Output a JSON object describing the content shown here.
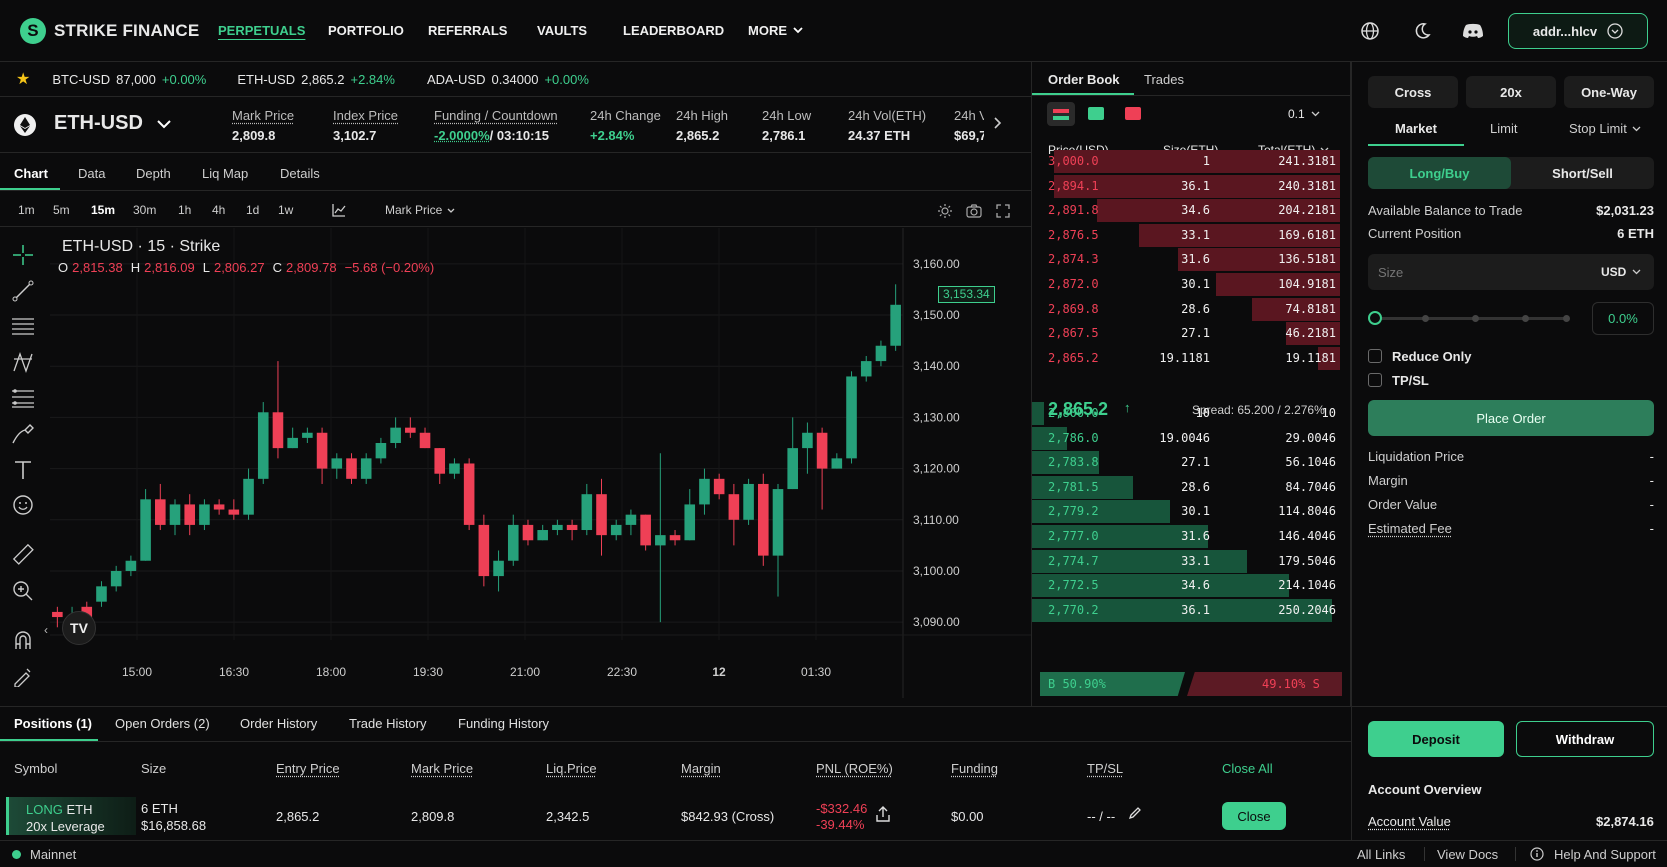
{
  "brand": {
    "name": "STRIKE FINANCE"
  },
  "nav": {
    "items": [
      "PERPETUALS",
      "PORTFOLIO",
      "REFERRALS",
      "VAULTS",
      "LEADERBOARD",
      "MORE"
    ],
    "address": "addr...hlcv"
  },
  "ticker": [
    {
      "symbol": "BTC-USD",
      "price": "87,000",
      "change": "+0.00%"
    },
    {
      "symbol": "ETH-USD",
      "price": "2,865.2",
      "change": "+2.84%"
    },
    {
      "symbol": "ADA-USD",
      "price": "0.34000",
      "change": "+0.00%"
    }
  ],
  "market": {
    "symbol": "ETH-USD",
    "stats": [
      {
        "label": "Mark Price",
        "value": "2,809.8"
      },
      {
        "label": "Index Price",
        "value": "3,102.7"
      },
      {
        "label": "Funding / Countdown",
        "value_a": "-2.0000%",
        "value_b": "/ 03:10:15"
      },
      {
        "label": "24h Change",
        "value": "+2.84%"
      },
      {
        "label": "24h High",
        "value": "2,865.2"
      },
      {
        "label": "24h Low",
        "value": "2,786.1"
      },
      {
        "label": "24h Vol(ETH)",
        "value": "24.37 ETH"
      },
      {
        "label": "24h V",
        "value": "$69,7"
      }
    ]
  },
  "chart_tabs": [
    "Chart",
    "Data",
    "Depth",
    "Liq Map",
    "Details"
  ],
  "timeframes": [
    "1m",
    "5m",
    "15m",
    "30m",
    "1h",
    "4h",
    "1d",
    "1w"
  ],
  "price_source": "Mark Price",
  "chart": {
    "title": "ETH-USD · 15 · Strike",
    "ohlc": {
      "o_label": "O",
      "o": "2,815.38",
      "h_label": "H",
      "h": "2,816.09",
      "l_label": "L",
      "l": "2,806.27",
      "c_label": "C",
      "c": "2,809.78",
      "chg": "−5.68 (−0.20%)"
    },
    "last_price_tag": "3,153.34"
  },
  "chart_data": {
    "type": "candlestick",
    "x_labels": [
      "15:00",
      "16:30",
      "18:00",
      "19:30",
      "21:00",
      "22:30",
      "12",
      "01:30"
    ],
    "y_ticks": [
      3160,
      3150,
      3140,
      3130,
      3120,
      3110,
      3100,
      3090
    ],
    "ylim": [
      3083,
      3167
    ],
    "candles": [
      [
        3092,
        3091,
        3093,
        3089
      ],
      [
        3089,
        3091,
        3093,
        3088
      ],
      [
        3093,
        3088,
        3094,
        3087
      ],
      [
        3094,
        3097,
        3098,
        3093
      ],
      [
        3097,
        3100,
        3101,
        3096
      ],
      [
        3100,
        3102,
        3103,
        3099
      ],
      [
        3102,
        3114,
        3116,
        3102
      ],
      [
        3114,
        3109,
        3117,
        3108
      ],
      [
        3109,
        3113,
        3114,
        3107
      ],
      [
        3113,
        3109,
        3115,
        3107
      ],
      [
        3109,
        3113,
        3114,
        3108
      ],
      [
        3113,
        3112,
        3114,
        3111
      ],
      [
        3112,
        3111,
        3114,
        3110
      ],
      [
        3111,
        3118,
        3120,
        3110
      ],
      [
        3118,
        3131,
        3133,
        3117
      ],
      [
        3131,
        3124,
        3141,
        3122
      ],
      [
        3124,
        3126,
        3128,
        3124
      ],
      [
        3126,
        3127,
        3128,
        3125
      ],
      [
        3127,
        3120,
        3128,
        3117
      ],
      [
        3120,
        3122,
        3123,
        3118
      ],
      [
        3122,
        3118,
        3123,
        3117
      ],
      [
        3118,
        3122,
        3123,
        3117
      ],
      [
        3122,
        3125,
        3126,
        3121
      ],
      [
        3125,
        3128,
        3130,
        3124
      ],
      [
        3128,
        3127,
        3130,
        3126
      ],
      [
        3127,
        3124,
        3128,
        3124
      ],
      [
        3124,
        3119,
        3124,
        3117
      ],
      [
        3119,
        3121,
        3122,
        3118
      ],
      [
        3121,
        3109,
        3122,
        3108
      ],
      [
        3109,
        3099,
        3111,
        3097
      ],
      [
        3099,
        3102,
        3104,
        3096
      ],
      [
        3102,
        3109,
        3111,
        3101
      ],
      [
        3109,
        3106,
        3110,
        3105
      ],
      [
        3106,
        3108,
        3109,
        3106
      ],
      [
        3108,
        3109,
        3110,
        3107
      ],
      [
        3109,
        3108,
        3110,
        3106
      ],
      [
        3108,
        3115,
        3117,
        3107
      ],
      [
        3115,
        3107,
        3118,
        3103
      ],
      [
        3107,
        3109,
        3110,
        3106
      ],
      [
        3109,
        3111,
        3112,
        3107
      ],
      [
        3111,
        3105,
        3111,
        3104
      ],
      [
        3105,
        3107,
        3123,
        3090
      ],
      [
        3107,
        3106,
        3108,
        3105
      ],
      [
        3106,
        3113,
        3116,
        3106
      ],
      [
        3113,
        3118,
        3120,
        3111
      ],
      [
        3118,
        3115,
        3119,
        3114
      ],
      [
        3115,
        3110,
        3117,
        3105
      ],
      [
        3110,
        3117,
        3118,
        3109
      ],
      [
        3117,
        3103,
        3119,
        3101
      ],
      [
        3103,
        3116,
        3117,
        3095
      ],
      [
        3116,
        3124,
        3130,
        3116
      ],
      [
        3124,
        3127,
        3129,
        3119
      ],
      [
        3127,
        3120,
        3128,
        3112
      ],
      [
        3120,
        3122,
        3123,
        3120
      ],
      [
        3122,
        3138,
        3139,
        3121
      ],
      [
        3138,
        3141,
        3142,
        3137
      ],
      [
        3141,
        3144,
        3145,
        3140
      ],
      [
        3144,
        3152,
        3156,
        3143
      ]
    ]
  },
  "orderbook": {
    "tabs": [
      "Order Book",
      "Trades"
    ],
    "grouping": "0.1",
    "headers": [
      "Price(USD)",
      "Size(ETH)",
      "Total(ETH)"
    ],
    "asks": [
      [
        "3,000.0",
        "1",
        "241.3181"
      ],
      [
        "2,894.1",
        "36.1",
        "240.3181"
      ],
      [
        "2,891.8",
        "34.6",
        "204.2181"
      ],
      [
        "2,876.5",
        "33.1",
        "169.6181"
      ],
      [
        "2,874.3",
        "31.6",
        "136.5181"
      ],
      [
        "2,872.0",
        "30.1",
        "104.9181"
      ],
      [
        "2,869.8",
        "28.6",
        "74.8181"
      ],
      [
        "2,867.5",
        "27.1",
        "46.2181"
      ],
      [
        "2,865.2",
        "19.1181",
        "19.1181"
      ]
    ],
    "ask_depth": [
      0.955,
      0.955,
      0.81,
      0.67,
      0.54,
      0.415,
      0.295,
      0.18,
      0.075
    ],
    "mid_price": "2,865.2",
    "spread": "Spread: 65.200 / 2.276%",
    "bids": [
      [
        "2,800.0",
        "10",
        "10"
      ],
      [
        "2,786.0",
        "19.0046",
        "29.0046"
      ],
      [
        "2,783.8",
        "27.1",
        "56.1046"
      ],
      [
        "2,781.5",
        "28.6",
        "84.7046"
      ],
      [
        "2,779.2",
        "30.1",
        "114.8046"
      ],
      [
        "2,777.0",
        "31.6",
        "146.4046"
      ],
      [
        "2,774.7",
        "33.1",
        "179.5046"
      ],
      [
        "2,772.5",
        "34.6",
        "214.1046"
      ],
      [
        "2,770.2",
        "36.1",
        "250.2046"
      ]
    ],
    "bid_depth": [
      0.04,
      0.116,
      0.224,
      0.338,
      0.459,
      0.585,
      0.717,
      0.856,
      1.0
    ],
    "buy_ratio": "B 50.90%",
    "sell_ratio": "49.10% S"
  },
  "order_form": {
    "margin_mode": "Cross",
    "leverage": "20x",
    "position_mode": "One-Way",
    "order_types": [
      "Market",
      "Limit",
      "Stop Limit"
    ],
    "side_buy": "Long/Buy",
    "side_sell": "Short/Sell",
    "available_label": "Available Balance to Trade",
    "available_value": "$2,031.23",
    "current_label": "Current Position",
    "current_value": "6 ETH",
    "size_placeholder": "Size",
    "size_unit": "USD",
    "slider_pct": "0.0%",
    "reduce_only": "Reduce Only",
    "tpsl": "TP/SL",
    "place_order": "Place Order",
    "summary": [
      {
        "label": "Liquidation Price",
        "value": "-"
      },
      {
        "label": "Margin",
        "value": "-"
      },
      {
        "label": "Order Value",
        "value": "-"
      },
      {
        "label": "Estimated Fee",
        "value": "-"
      }
    ],
    "deposit": "Deposit",
    "withdraw": "Withdraw",
    "account_title": "Account Overview",
    "account_value_label": "Account Value",
    "account_value": "$2,874.16"
  },
  "positions": {
    "tabs": [
      "Positions (1)",
      "Open Orders (2)",
      "Order History",
      "Trade History",
      "Funding History"
    ],
    "headers": [
      "Symbol",
      "Size",
      "Entry Price",
      "Mark Price",
      "Liq.Price",
      "Margin",
      "PNL (ROE%)",
      "Funding",
      "TP/SL"
    ],
    "close_all": "Close All",
    "row": {
      "side": "LONG",
      "asset": "ETH",
      "leverage": "20x Leverage",
      "size": "6 ETH",
      "size_usd": "$16,858.68",
      "entry": "2,865.2",
      "mark": "2,809.8",
      "liq": "2,342.5",
      "margin": "$842.93 (Cross)",
      "pnl": "-$332.46",
      "roe": "-39.44%",
      "funding": "$0.00",
      "tpsl": "-- / --",
      "close": "Close"
    }
  },
  "footer": {
    "network": "Mainnet",
    "links": [
      "All Links",
      "View Docs",
      "Help And Support"
    ]
  },
  "colors": {
    "green": "#3ecf8e",
    "red": "#ef4056",
    "bg": "#0b0b0c"
  }
}
